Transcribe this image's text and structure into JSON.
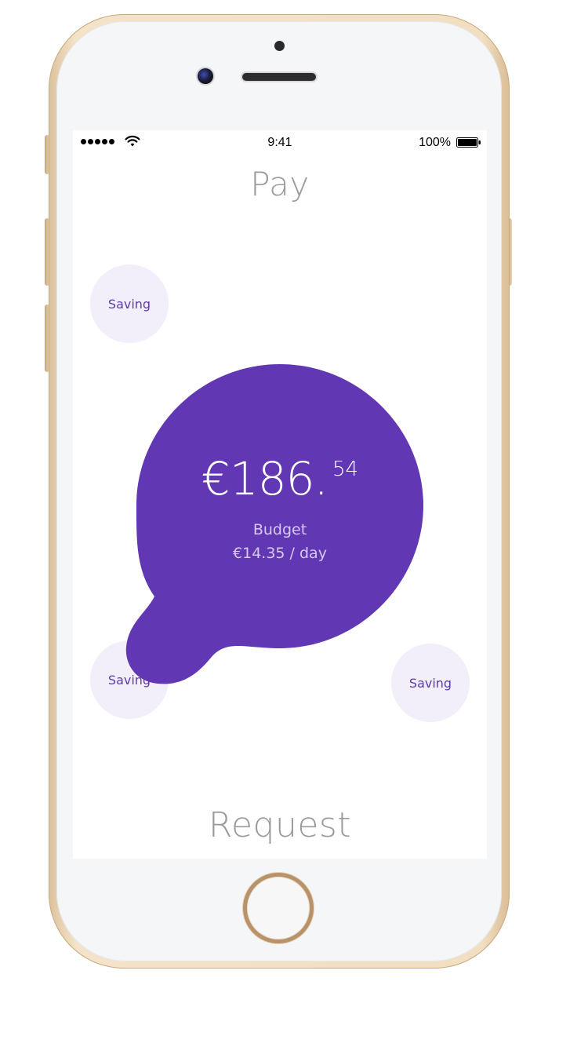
{
  "status_bar": {
    "time": "9:41",
    "battery_percent": "100%",
    "signal_icon": "signal-dots-icon",
    "wifi_icon": "wifi-icon",
    "battery_icon": "battery-full-icon"
  },
  "screen": {
    "title_top": "Pay",
    "title_bottom": "Request"
  },
  "budget": {
    "amount_main": "€186.",
    "amount_cents": "54",
    "label": "Budget",
    "daily_rate": "€14.35 / day"
  },
  "savings": [
    {
      "label": "Saving"
    },
    {
      "label": "Saving"
    },
    {
      "label": "Saving"
    }
  ],
  "colors": {
    "accent_purple": "#6237b3",
    "bubble_bg": "#f2eefa",
    "bubble_text": "#5e3bae",
    "title_gray": "#9a9a9a",
    "frame_gold": "#f2dfc2"
  }
}
